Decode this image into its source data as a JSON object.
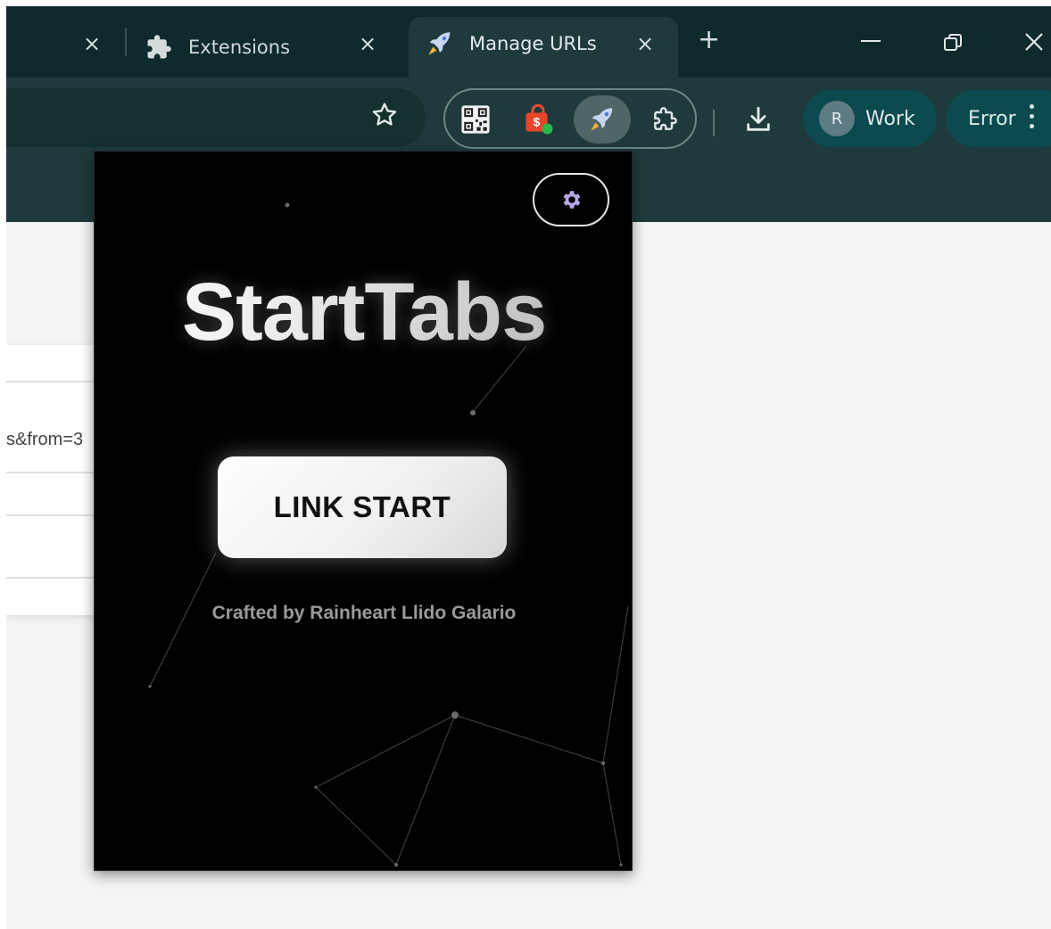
{
  "browser": {
    "tabs": [
      {
        "label": "Extensions",
        "active": false,
        "icon": "puzzle-icon"
      },
      {
        "label": "Manage URLs",
        "active": true,
        "icon": "rocket-icon"
      }
    ],
    "new_tab_symbol": "+",
    "close_symbol": "×",
    "window_controls": [
      "minimize-icon",
      "restore-icon",
      "close-icon"
    ],
    "toolbar": {
      "extensions": [
        "qr-code-icon",
        "shopping-bag-icon",
        "rocket-icon",
        "puzzle-icon"
      ],
      "profile": {
        "initial": "R",
        "label": "Work"
      },
      "error_label": "Error"
    }
  },
  "page": {
    "url_fragment": "s&from=3"
  },
  "popup": {
    "settings_icon": "gear-icon",
    "title": "StartTabs",
    "button_label": "LINK START",
    "credit": "Crafted by Rainheart Llido Galario"
  },
  "colors": {
    "tabstrip": "#0f2a2c",
    "toolbar": "#1f3a3c",
    "profile_chip": "#0b4a4f",
    "popup_bg": "#000000",
    "gear": "#b9a7e6"
  }
}
